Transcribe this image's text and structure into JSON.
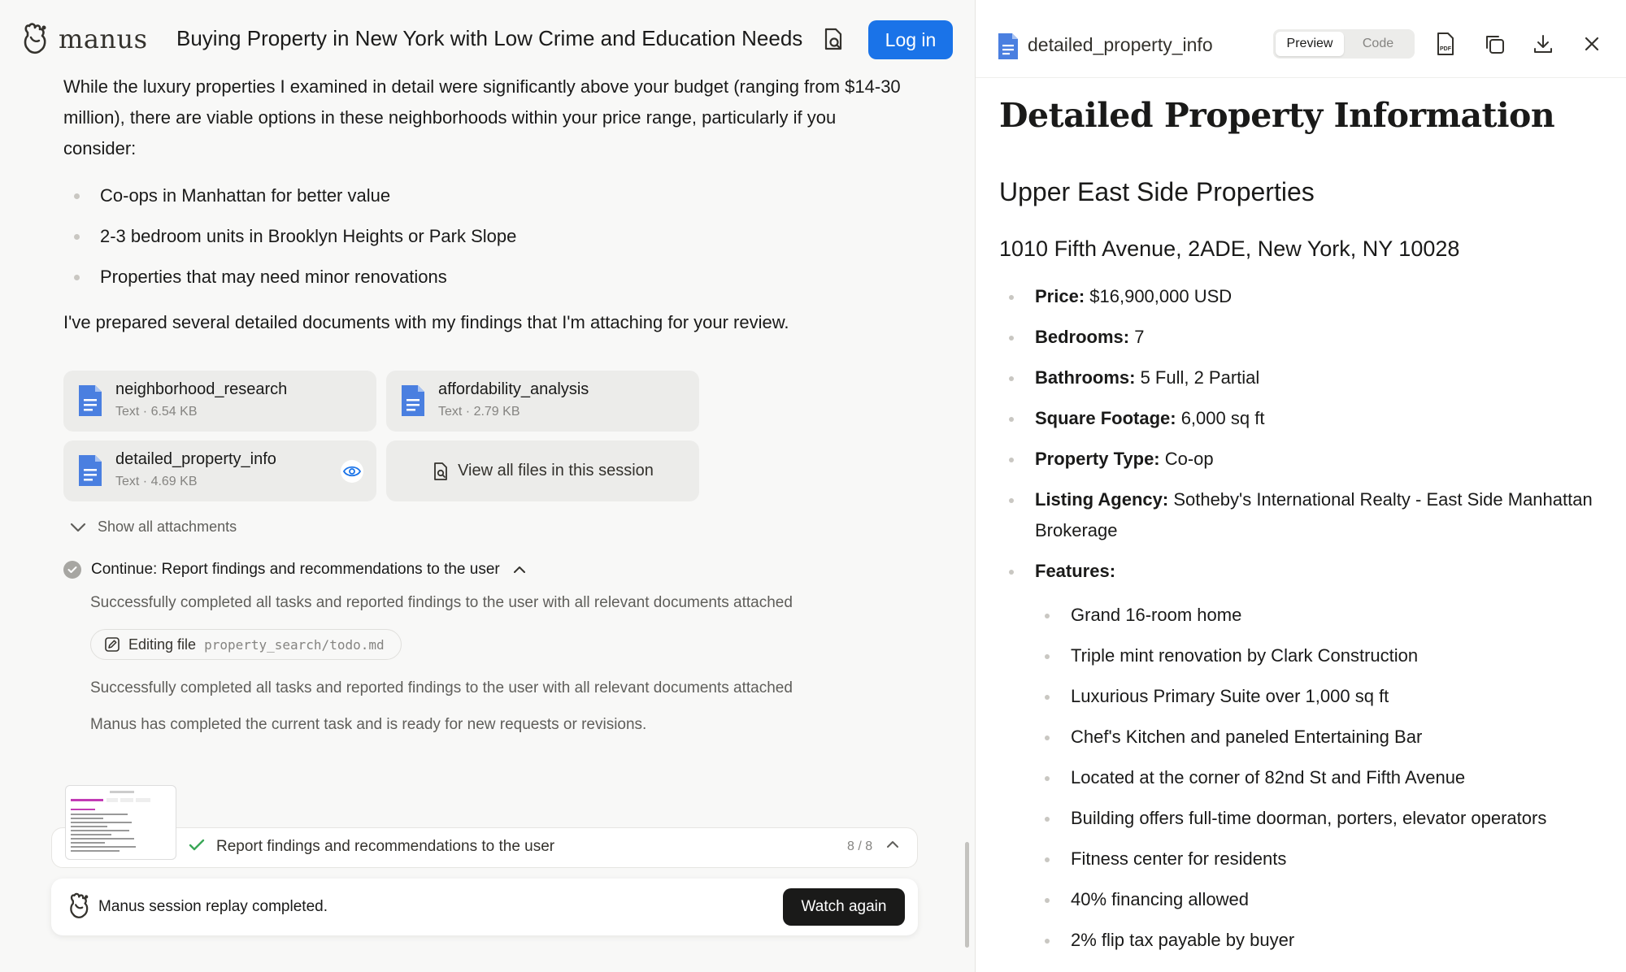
{
  "header": {
    "logo_text": "manus",
    "task_title": "Buying Property in New York with Low Crime and Education Needs",
    "login_label": "Log in"
  },
  "chat": {
    "intro_paragraph": "While the luxury properties I examined in detail were significantly above your budget (ranging from $14-30 million), there are viable options in these neighborhoods within your price range, particularly if you consider:",
    "bullets": [
      "Co-ops in Manhattan for better value",
      "2-3 bedroom units in Brooklyn Heights or Park Slope",
      "Properties that may need minor renovations"
    ],
    "closing_paragraph": "I've prepared several detailed documents with my findings that I'm attaching for your review.",
    "attachments": [
      {
        "name": "neighborhood_research",
        "meta": "Text · 6.54 KB"
      },
      {
        "name": "affordability_analysis",
        "meta": "Text · 2.79 KB"
      },
      {
        "name": "detailed_property_info",
        "meta": "Text · 4.69 KB"
      }
    ],
    "view_all_label": "View all files in this session",
    "show_all_label": "Show all attachments",
    "step_title": "Continue: Report findings and recommendations to the user",
    "step_line_1": "Successfully completed all tasks and reported findings to the user with all relevant documents attached",
    "edit_chip_label": "Editing file",
    "edit_chip_path": "property_search/todo.md",
    "step_line_2": "Successfully completed all tasks and reported findings to the user with all relevant documents attached",
    "step_line_3": "Manus has completed the current task and is ready for new requests or revisions.",
    "progress_label": "Report findings and recommendations to the user",
    "progress_count": "8 / 8",
    "replay_text": "Manus session replay completed.",
    "watch_again_label": "Watch again"
  },
  "preview": {
    "file_name": "detailed_property_info",
    "tab_preview": "Preview",
    "tab_code": "Code",
    "h1": "Detailed Property Information",
    "h2": "Upper East Side Properties",
    "h3": "1010 Fifth Avenue, 2ADE, New York, NY 10028",
    "fields": [
      {
        "label": "Price:",
        "value": " $16,900,000 USD"
      },
      {
        "label": "Bedrooms:",
        "value": " 7"
      },
      {
        "label": "Bathrooms:",
        "value": " 5 Full, 2 Partial"
      },
      {
        "label": "Square Footage:",
        "value": " 6,000 sq ft"
      },
      {
        "label": "Property Type:",
        "value": " Co-op"
      },
      {
        "label": "Listing Agency:",
        "value": " Sotheby's International Realty - East Side Manhattan Brokerage"
      },
      {
        "label": "Features:",
        "value": ""
      }
    ],
    "features": [
      "Grand 16-room home",
      "Triple mint renovation by Clark Construction",
      "Luxurious Primary Suite over 1,000 sq ft",
      "Chef's Kitchen and paneled Entertaining Bar",
      "Located at the corner of 82nd St and Fifth Avenue",
      "Building offers full-time doorman, porters, elevator operators",
      "Fitness center for residents",
      "40% financing allowed",
      "2% flip tax payable by buyer"
    ]
  },
  "colors": {
    "accent_blue": "#1a73e8",
    "doc_icon_blue": "#4a7fe0",
    "dark_button": "#1a1a19"
  }
}
